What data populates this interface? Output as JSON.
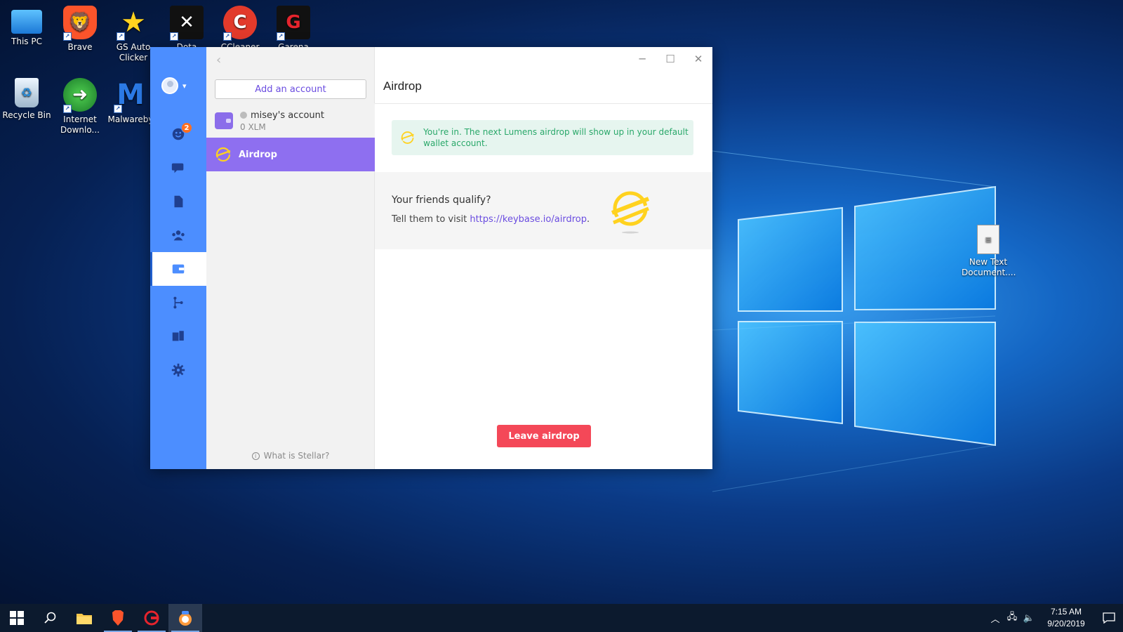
{
  "desktop": {
    "icons": [
      {
        "label": "This PC"
      },
      {
        "label": "Brave"
      },
      {
        "label": "GS Auto Clicker"
      },
      {
        "label": "Dota"
      },
      {
        "label": "CCleaner"
      },
      {
        "label": "Garena"
      },
      {
        "label": "Recycle Bin"
      },
      {
        "label": "Internet Downlo..."
      },
      {
        "label": "Malwareby"
      },
      {
        "label": "New Text Document...."
      }
    ]
  },
  "keybase": {
    "nav": {
      "badge_count": "2",
      "items": [
        "people",
        "chat",
        "files",
        "teams",
        "wallet",
        "git",
        "devices",
        "settings"
      ],
      "active": "wallet"
    },
    "accounts": {
      "add_account_label": "Add an account",
      "account_name": "misey's account",
      "account_balance": "0 XLM",
      "airdrop_label": "Airdrop",
      "what_is_stellar": "What is Stellar?"
    },
    "main": {
      "title": "Airdrop",
      "notice": "You're in. The next Lumens airdrop will show up in your default wallet account.",
      "friends_title": "Your friends qualify?",
      "friends_text": "Tell them to visit ",
      "friends_link": "https://keybase.io/airdrop",
      "friends_period": ".",
      "leave_button": "Leave airdrop"
    }
  },
  "taskbar": {
    "time": "7:15 AM",
    "date": "9/20/2019"
  },
  "colors": {
    "nav_blue": "#4c8eff",
    "purple": "#8e6ff0",
    "green_text": "#2aa86a",
    "red_button": "#f44858"
  }
}
